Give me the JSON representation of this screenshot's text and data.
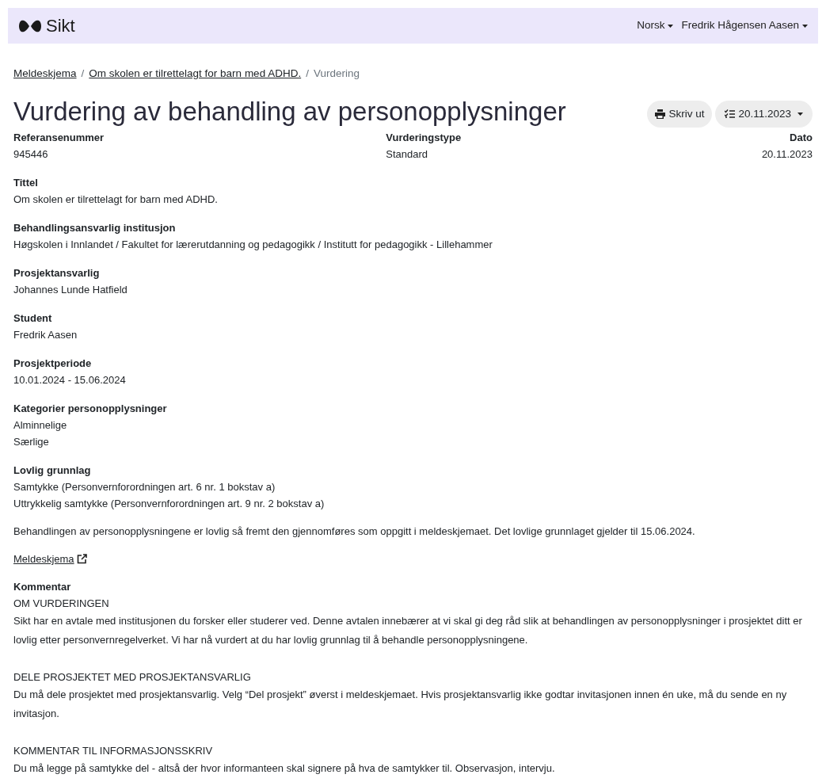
{
  "nav": {
    "logo": "Sikt",
    "menus": [
      {
        "label": "Norsk"
      },
      {
        "label": "Fredrik Hågensen Aasen"
      }
    ]
  },
  "breadcrumb_separator": "/",
  "breadcrumbs": [
    {
      "label": "Meldeskjema",
      "kind": "link"
    },
    {
      "label": "Om skolen er tilrettelagt for barn med ADHD.",
      "kind": "link"
    },
    {
      "label": "Vurdering",
      "kind": "current"
    }
  ],
  "title": "Vurdering av behandling av personopplysninger",
  "actions": {
    "print_button": "Skriv ut",
    "version_dropdown": "20.11.2023"
  },
  "summary": [
    {
      "label": "Referansenummer",
      "value": "945446"
    },
    {
      "label": "Vurderingstype",
      "value": "Standard"
    },
    {
      "label": "Dato",
      "value": "20.11.2023"
    }
  ],
  "fields": [
    {
      "label": "Tittel",
      "values": [
        "Om skolen er tilrettelagt for barn med ADHD."
      ]
    },
    {
      "label": "Behandlingsansvarlig institusjon",
      "values": [
        "Høgskolen i Innlandet / Fakultet for lærerutdanning og pedagogikk / Institutt for pedagogikk - Lillehammer"
      ]
    },
    {
      "label": "Prosjektansvarlig",
      "values": [
        "Johannes Lunde Hatfield"
      ]
    },
    {
      "label": "Student",
      "values": [
        "Fredrik Aasen"
      ]
    },
    {
      "label": "Prosjektperiode",
      "values": [
        "10.01.2024 - 15.06.2024"
      ]
    },
    {
      "label": "Kategorier personopplysninger",
      "values": [
        "Alminnelige",
        "Særlige"
      ]
    },
    {
      "label": "Lovlig grunnlag",
      "values": [
        "Samtykke (Personvernforordningen art. 6 nr. 1 bokstav a)",
        "Uttrykkelig samtykke (Personvernforordningen art. 9 nr. 2 bokstav a)"
      ]
    }
  ],
  "statement": "Behandlingen av personopplysningene er lovlig så fremt den gjennomføres som oppgitt i meldeskjemaet. Det lovlige grunnlaget gjelder til 15.06.2024.",
  "form_link": "Meldeskjema",
  "comment": {
    "label": "Kommentar",
    "sections": [
      {
        "heading": "OM VURDERINGEN",
        "text": "Sikt har en avtale med institusjonen du forsker eller studerer ved. Denne avtalen innebærer at vi skal gi deg råd slik at behandlingen av personopplysninger i prosjektet ditt er lovlig etter personvernregelverket. Vi har nå vurdert at du har lovlig grunnlag til å behandle personopplysningene."
      },
      {
        "heading": "DELE PROSJEKTET MED PROSJEKTANSVARLIG",
        "text": "Du må dele prosjektet med prosjektansvarlig. Velg “Del prosjekt” øverst i meldeskjemaet. Hvis prosjektansvarlig ikke godtar invitasjonen innen én uke, må du sende en ny invitasjon."
      },
      {
        "heading": "KOMMENTAR TIL INFORMASJONSSKRIV",
        "text": "Du må legge på samtykke del - altså der hvor informanteen skal signere på hva de samtykker til. Observasjon, intervju."
      }
    ]
  }
}
